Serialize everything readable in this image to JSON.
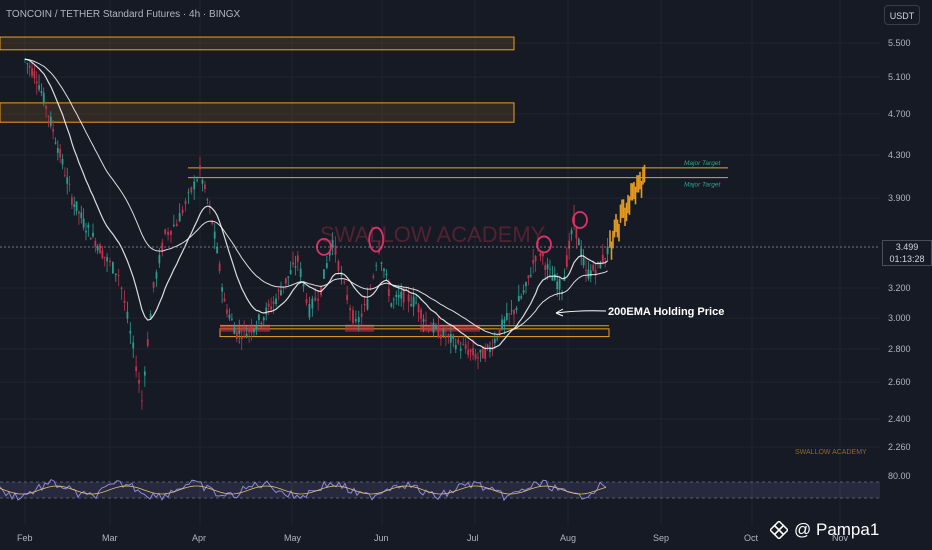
{
  "header": {
    "title": "TONCOIN / TETHER Standard Futures · 4h · BINGX",
    "currency": "USDT"
  },
  "price_badge": {
    "price": "3.499",
    "countdown": "01:13:28"
  },
  "watermark": {
    "handle": "@ Pampa1",
    "icon": "binance-square-icon"
  },
  "colors": {
    "background": "#161a25",
    "zone": "#f0a020",
    "up_candle": "#2a9d8f",
    "down_candle": "#c2334a",
    "ema_line": "#ffffff",
    "projection": "#e69a1e",
    "circle": "#e0306a",
    "oscillator": "#8e88d6",
    "target_label": "#2aa59a"
  },
  "chart_data": {
    "type": "candlestick",
    "title": "TONCOIN / TETHER Standard Futures · 4h · BINGX",
    "yticks": [
      "5.500",
      "5.100",
      "4.700",
      "4.300",
      "3.900",
      "3.200",
      "3.000",
      "2.800",
      "2.600",
      "2.400",
      "2.260"
    ],
    "xticks": [
      "Feb",
      "Mar",
      "Apr",
      "May",
      "Jun",
      "Jul",
      "Aug",
      "Sep",
      "Oct",
      "Nov"
    ],
    "ylim": [
      2.2,
      5.6
    ],
    "scale": "log",
    "current_price": 3.499,
    "series": [
      {
        "kind": "price_path",
        "x": [
          "Feb 1",
          "Feb 5",
          "Feb 9",
          "Feb 13",
          "Feb 17",
          "Feb 21",
          "Feb 25",
          "Feb 29",
          "Mar 4",
          "Mar 8",
          "Mar 12",
          "Mar 16",
          "Mar 20",
          "Mar 24",
          "Mar 28",
          "Apr 1",
          "Apr 5",
          "Apr 9",
          "Apr 13",
          "Apr 17",
          "Apr 21",
          "Apr 25",
          "Apr 29",
          "May 3",
          "May 7",
          "May 11",
          "May 15",
          "May 19",
          "May 23",
          "May 27",
          "May 31",
          "Jun 4",
          "Jun 8",
          "Jun 12",
          "Jun 16",
          "Jun 20",
          "Jun 24",
          "Jun 28",
          "Jul 2",
          "Jul 6",
          "Jul 10",
          "Jul 14",
          "Jul 18",
          "Jul 22",
          "Jul 26",
          "Jul 30",
          "Aug 3",
          "Aug 7",
          "Aug 11",
          "Aug 15"
        ],
        "values": [
          5.3,
          5.1,
          4.7,
          4.3,
          3.9,
          3.7,
          3.55,
          3.4,
          3.3,
          2.9,
          2.5,
          3.2,
          3.6,
          3.7,
          3.9,
          4.15,
          3.7,
          3.1,
          2.9,
          2.92,
          3.0,
          3.1,
          3.25,
          3.4,
          3.05,
          3.2,
          3.55,
          3.2,
          2.95,
          3.1,
          3.5,
          3.1,
          3.15,
          3.1,
          2.95,
          2.9,
          2.85,
          2.8,
          2.75,
          2.8,
          2.95,
          3.05,
          3.2,
          3.5,
          3.3,
          3.2,
          3.7,
          3.3,
          3.35,
          3.5
        ]
      },
      {
        "kind": "projection",
        "x": [
          "Aug 15",
          "Aug 19",
          "Aug 23",
          "Aug 27"
        ],
        "values": [
          3.5,
          3.75,
          3.95,
          4.1
        ]
      }
    ],
    "zones": [
      {
        "low": 5.42,
        "high": 5.57
      },
      {
        "low": 4.62,
        "high": 4.82
      },
      {
        "low": 2.88,
        "high": 2.93
      }
    ],
    "levels": [
      {
        "value": 4.18,
        "label": "Major Target"
      },
      {
        "value": 4.09,
        "label": "Major Target"
      },
      {
        "value": 2.95,
        "label": ""
      }
    ],
    "annotations": [
      {
        "text": "200EMA Holding Price"
      },
      {
        "text": "SWALLOW ACADEMY"
      }
    ],
    "oscillator": {
      "level_label": "80.00"
    }
  }
}
